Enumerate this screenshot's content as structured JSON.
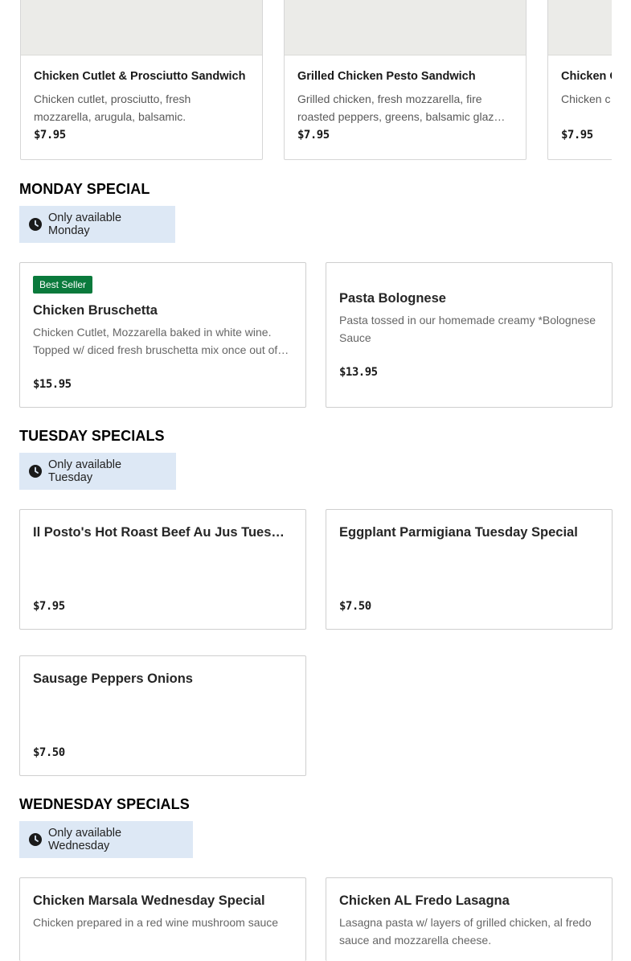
{
  "carousel": {
    "items": [
      {
        "name": "Chicken Cutlet & Prosciutto Sandwich",
        "description": "Chicken cutlet, prosciutto, fresh mozzarella, arugula, balsamic.",
        "price": "$7.95"
      },
      {
        "name": "Grilled Chicken Pesto Sandwich",
        "description": "Grilled chicken, fresh mozzarella, fire roasted peppers, greens, balsamic glaze, pesto.",
        "price": "$7.95"
      },
      {
        "name": "Chicken C",
        "description": "Chicken c peppers, c",
        "price": "$7.95"
      }
    ]
  },
  "monday": {
    "title": "MONDAY SPECIAL",
    "availability": "Only available Monday",
    "items": [
      {
        "badge": "Best Seller",
        "name": "Chicken Bruschetta",
        "description": "Chicken Cutlet, Mozzarella baked in white wine. Topped w/ diced fresh bruschetta mix once out of the oven.",
        "price": "$15.95"
      },
      {
        "name": "Pasta Bolognese",
        "description": "Pasta tossed in our homemade creamy *Bolognese Sauce",
        "price": "$13.95"
      }
    ]
  },
  "tuesday": {
    "title": "TUESDAY SPECIALS",
    "availability": "Only available Tuesday",
    "items": [
      {
        "name": "Il Posto's Hot Roast Beef Au Jus Tuesday Special",
        "price": "$7.95"
      },
      {
        "name": "Eggplant Parmigiana Tuesday Special",
        "price": "$7.50"
      },
      {
        "name": "Sausage Peppers Onions",
        "price": "$7.50"
      }
    ]
  },
  "wednesday": {
    "title": "WEDNESDAY SPECIALS",
    "availability": "Only available Wednesday",
    "items": [
      {
        "name": "Chicken Marsala Wednesday Special",
        "description": "Chicken prepared in a red wine mushroom sauce"
      },
      {
        "name": "Chicken AL Fredo Lasagna",
        "description": "Lasagna pasta w/ layers of grilled chicken, al fredo sauce and mozzarella cheese."
      }
    ]
  },
  "icons": {
    "availability": "clock-icon"
  },
  "colors": {
    "availability_bg": "#dde8f5",
    "badge_bg": "#0a7a3c",
    "image_placeholder": "#ebebe8"
  }
}
